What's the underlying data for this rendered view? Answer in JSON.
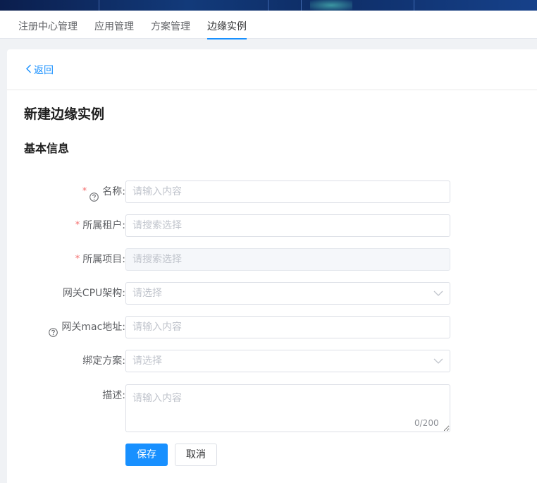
{
  "nav": {
    "tabs": [
      {
        "label": "注册中心管理"
      },
      {
        "label": "应用管理"
      },
      {
        "label": "方案管理"
      },
      {
        "label": "边缘实例"
      }
    ],
    "active_index": 3
  },
  "page": {
    "back_label": "返回",
    "title": "新建边缘实例",
    "section_title": "基本信息"
  },
  "form": {
    "name": {
      "label": "名称:",
      "placeholder": "请输入内容",
      "required": true,
      "help": true
    },
    "tenant": {
      "label": "所属租户:",
      "placeholder": "请搜索选择",
      "required": true
    },
    "project": {
      "label": "所属项目:",
      "placeholder": "请搜索选择",
      "required": true,
      "disabled": true
    },
    "cpu_arch": {
      "label": "网关CPU架构:",
      "placeholder": "请选择"
    },
    "mac": {
      "label": "网关mac地址:",
      "placeholder": "请输入内容",
      "help": true
    },
    "plan": {
      "label": "绑定方案:",
      "placeholder": "请选择"
    },
    "description": {
      "label": "描述:",
      "placeholder": "请输入内容",
      "counter": "0/200"
    },
    "required_mark": "*"
  },
  "actions": {
    "save_label": "保存",
    "cancel_label": "取消"
  },
  "colors": {
    "primary": "#1890ff",
    "required": "#f56c6c",
    "banner": "#0e2d66"
  }
}
